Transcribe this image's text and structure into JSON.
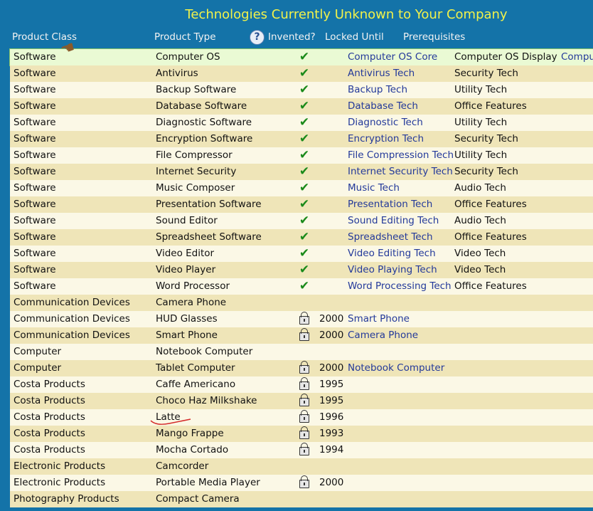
{
  "title": "Technologies Currently Unknown to Your Company",
  "columns": {
    "product_class": "Product Class",
    "product_type": "Product Type",
    "invented": "Invented?",
    "locked_until": "Locked Until",
    "prerequisites": "Prerequisites"
  },
  "help_icon_glyph": "?",
  "colors": {
    "title": "#f2f24a",
    "header_bg": "#1473a8",
    "row_light": "#fbf8e6",
    "row_dark": "#efe5b8",
    "link": "#23399a",
    "check": "#1a8a1a"
  },
  "rows": [
    {
      "cls": "Software",
      "type": "Computer OS",
      "check": true,
      "lock": false,
      "year": "",
      "p1": "Computer OS Core",
      "p2": "Computer OS Display",
      "p3": "Compu"
    },
    {
      "cls": "Software",
      "type": "Antivirus",
      "check": true,
      "lock": false,
      "year": "",
      "p1": "Antivirus Tech",
      "p2": "Security Tech",
      "p3": ""
    },
    {
      "cls": "Software",
      "type": "Backup Software",
      "check": true,
      "lock": false,
      "year": "",
      "p1": "Backup Tech",
      "p2": "Utility Tech",
      "p3": ""
    },
    {
      "cls": "Software",
      "type": "Database Software",
      "check": true,
      "lock": false,
      "year": "",
      "p1": "Database Tech",
      "p2": "Office Features",
      "p3": ""
    },
    {
      "cls": "Software",
      "type": "Diagnostic Software",
      "check": true,
      "lock": false,
      "year": "",
      "p1": "Diagnostic Tech",
      "p2": "Utility Tech",
      "p3": ""
    },
    {
      "cls": "Software",
      "type": "Encryption Software",
      "check": true,
      "lock": false,
      "year": "",
      "p1": "Encryption Tech",
      "p2": "Security Tech",
      "p3": ""
    },
    {
      "cls": "Software",
      "type": "File Compressor",
      "check": true,
      "lock": false,
      "year": "",
      "p1": "File Compression Tech",
      "p2": "Utility Tech",
      "p3": ""
    },
    {
      "cls": "Software",
      "type": "Internet Security",
      "check": true,
      "lock": false,
      "year": "",
      "p1": "Internet Security Tech",
      "p2": "Security Tech",
      "p3": ""
    },
    {
      "cls": "Software",
      "type": "Music Composer",
      "check": true,
      "lock": false,
      "year": "",
      "p1": "Music Tech",
      "p2": "Audio Tech",
      "p3": ""
    },
    {
      "cls": "Software",
      "type": "Presentation Software",
      "check": true,
      "lock": false,
      "year": "",
      "p1": "Presentation Tech",
      "p2": "Office Features",
      "p3": ""
    },
    {
      "cls": "Software",
      "type": "Sound Editor",
      "check": true,
      "lock": false,
      "year": "",
      "p1": "Sound Editing Tech",
      "p2": "Audio Tech",
      "p3": ""
    },
    {
      "cls": "Software",
      "type": "Spreadsheet Software",
      "check": true,
      "lock": false,
      "year": "",
      "p1": "Spreadsheet Tech",
      "p2": "Office Features",
      "p3": ""
    },
    {
      "cls": "Software",
      "type": "Video Editor",
      "check": true,
      "lock": false,
      "year": "",
      "p1": "Video Editing Tech",
      "p2": "Video Tech",
      "p3": ""
    },
    {
      "cls": "Software",
      "type": "Video Player",
      "check": true,
      "lock": false,
      "year": "",
      "p1": "Video Playing Tech",
      "p2": "Video Tech",
      "p3": ""
    },
    {
      "cls": "Software",
      "type": "Word Processor",
      "check": true,
      "lock": false,
      "year": "",
      "p1": "Word Processing Tech",
      "p2": "Office Features",
      "p3": ""
    },
    {
      "cls": "Communication Devices",
      "type": "Camera Phone",
      "check": false,
      "lock": false,
      "year": "",
      "p1": "",
      "p2": "",
      "p3": ""
    },
    {
      "cls": "Communication Devices",
      "type": "HUD Glasses",
      "check": false,
      "lock": true,
      "year": "2000",
      "p1": "Smart Phone",
      "p2": "",
      "p3": ""
    },
    {
      "cls": "Communication Devices",
      "type": "Smart Phone",
      "check": false,
      "lock": true,
      "year": "2000",
      "p1": "Camera Phone",
      "p2": "",
      "p3": ""
    },
    {
      "cls": "Computer",
      "type": "Notebook Computer",
      "check": false,
      "lock": false,
      "year": "",
      "p1": "",
      "p2": "",
      "p3": ""
    },
    {
      "cls": "Computer",
      "type": "Tablet Computer",
      "check": false,
      "lock": true,
      "year": "2000",
      "p1": "Notebook Computer",
      "p2": "",
      "p3": ""
    },
    {
      "cls": "Costa Products",
      "type": "Caffe Americano",
      "check": false,
      "lock": true,
      "year": "1995",
      "p1": "",
      "p2": "",
      "p3": ""
    },
    {
      "cls": "Costa Products",
      "type": "Choco Haz Milkshake",
      "check": false,
      "lock": true,
      "year": "1995",
      "p1": "",
      "p2": "",
      "p3": ""
    },
    {
      "cls": "Costa Products",
      "type": "Latte",
      "check": false,
      "lock": true,
      "year": "1996",
      "p1": "",
      "p2": "",
      "p3": ""
    },
    {
      "cls": "Costa Products",
      "type": "Mango Frappe",
      "check": false,
      "lock": true,
      "year": "1993",
      "p1": "",
      "p2": "",
      "p3": ""
    },
    {
      "cls": "Costa Products",
      "type": "Mocha Cortado",
      "check": false,
      "lock": true,
      "year": "1994",
      "p1": "",
      "p2": "",
      "p3": ""
    },
    {
      "cls": "Electronic Products",
      "type": "Camcorder",
      "check": false,
      "lock": false,
      "year": "",
      "p1": "",
      "p2": "",
      "p3": ""
    },
    {
      "cls": "Electronic Products",
      "type": "Portable Media Player",
      "check": false,
      "lock": true,
      "year": "2000",
      "p1": "",
      "p2": "",
      "p3": ""
    },
    {
      "cls": "Photography Products",
      "type": "Compact Camera",
      "check": false,
      "lock": false,
      "year": "",
      "p1": "",
      "p2": "",
      "p3": ""
    }
  ]
}
